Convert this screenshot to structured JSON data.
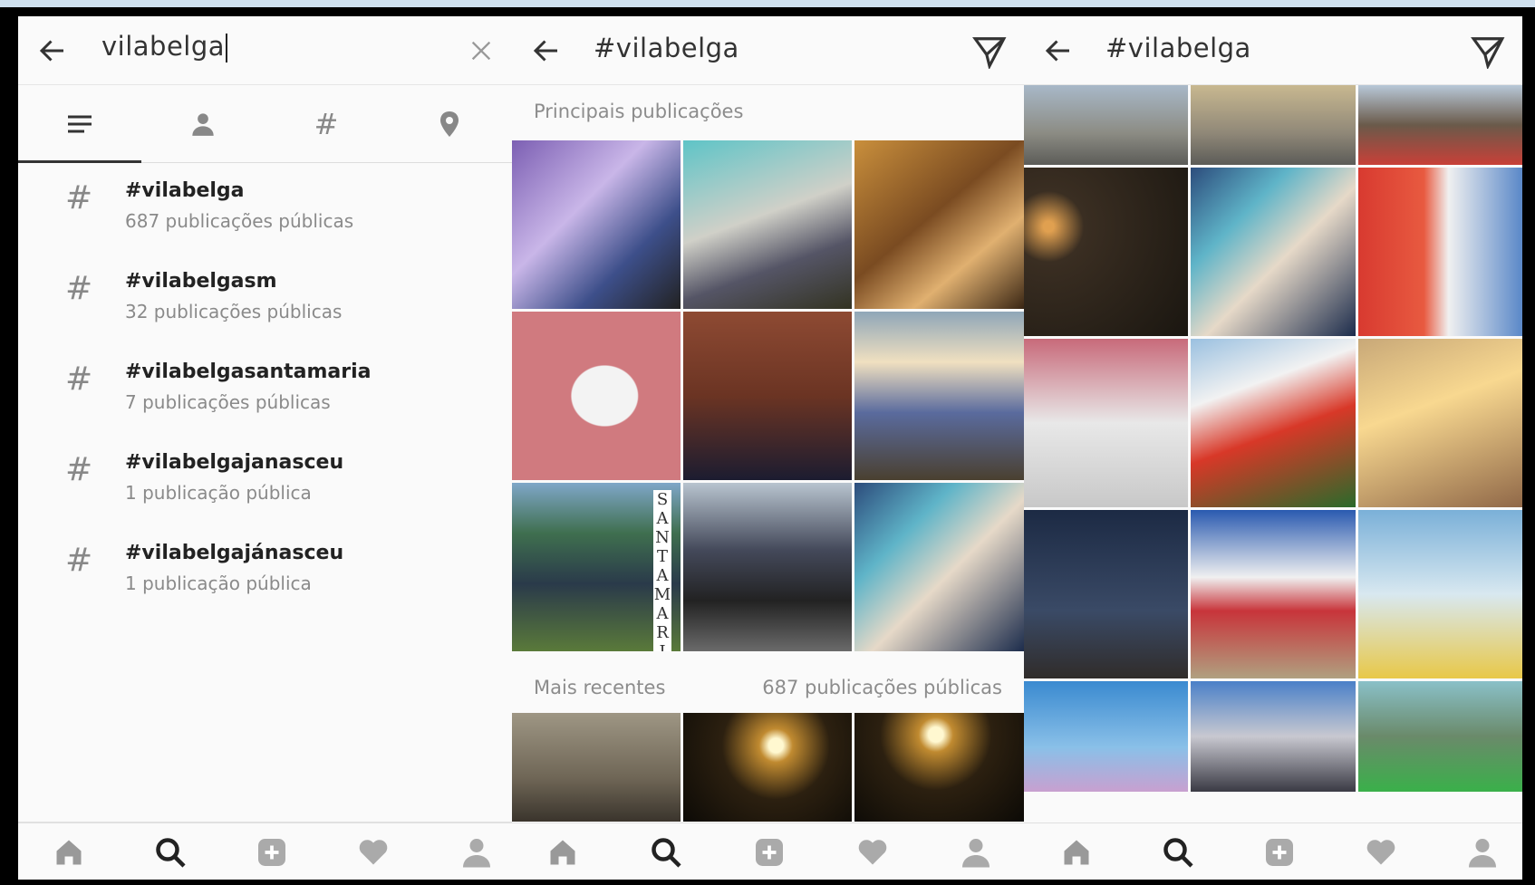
{
  "search_panel": {
    "query": "vilabelga",
    "tabs": [
      {
        "name": "tab-top",
        "icon": "lines-icon"
      },
      {
        "name": "tab-people",
        "icon": "person-icon"
      },
      {
        "name": "tab-tags",
        "icon": "hash-icon"
      },
      {
        "name": "tab-places",
        "icon": "location-pin-icon"
      }
    ],
    "results": [
      {
        "tag": "#vilabelga",
        "count": "687 publicações públicas"
      },
      {
        "tag": "#vilabelgasm",
        "count": "32 publicações públicas"
      },
      {
        "tag": "#vilabelgasantamaria",
        "count": "7 publicações públicas"
      },
      {
        "tag": "#vilabelgajanasceu",
        "count": "1 publicação pública"
      },
      {
        "tag": "#vilabelgajánasceu",
        "count": "1 publicação pública"
      }
    ],
    "hash_symbol": "#"
  },
  "tag_panel": {
    "title": "#vilabelga",
    "top_posts_label": "Principais publicações",
    "recent_label": "Mais recentes",
    "recent_count": "687 publicações públicas",
    "collage_text": "SANTA MARIA"
  },
  "grid_panel": {
    "title": "#vilabelga"
  },
  "nav": [
    "home-icon",
    "search-icon",
    "add-icon",
    "heart-icon",
    "profile-icon"
  ],
  "colors": {
    "background": "#fafafa",
    "text": "#222222",
    "muted": "#8a8a8a",
    "border": "#dddddd"
  }
}
